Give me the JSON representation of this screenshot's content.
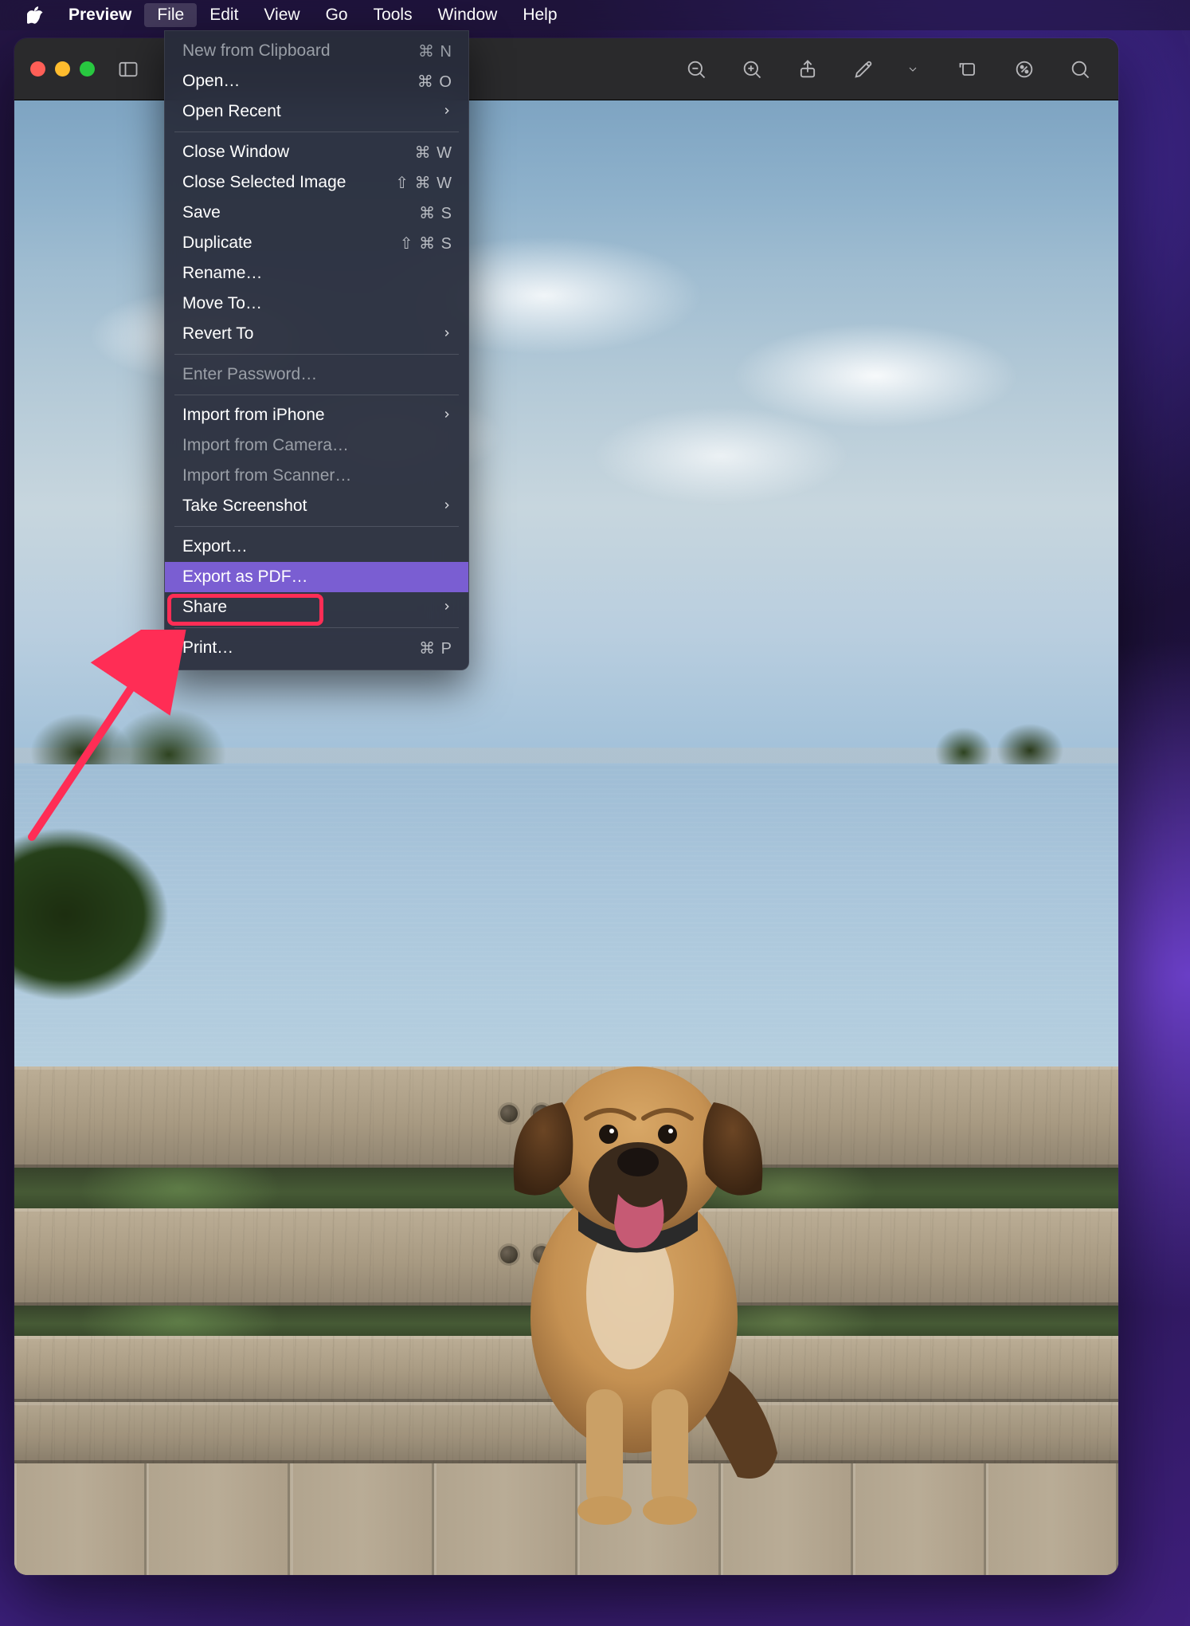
{
  "menubar": {
    "app": "Preview",
    "items": [
      "File",
      "Edit",
      "View",
      "Go",
      "Tools",
      "Window",
      "Help"
    ],
    "active_index": 0
  },
  "file_menu": {
    "groups": [
      [
        {
          "label": "New from Clipboard",
          "shortcut": "⌘ N",
          "dim": true
        },
        {
          "label": "Open…",
          "shortcut": "⌘ O"
        },
        {
          "label": "Open Recent",
          "submenu": true
        }
      ],
      [
        {
          "label": "Close Window",
          "shortcut": "⌘ W"
        },
        {
          "label": "Close Selected Image",
          "shortcut": "⇧ ⌘ W"
        },
        {
          "label": "Save",
          "shortcut": "⌘ S"
        },
        {
          "label": "Duplicate",
          "shortcut": "⇧ ⌘ S"
        },
        {
          "label": "Rename…"
        },
        {
          "label": "Move To…"
        },
        {
          "label": "Revert To",
          "submenu": true
        }
      ],
      [
        {
          "label": "Enter Password…",
          "dim": true
        }
      ],
      [
        {
          "label": "Import from iPhone",
          "submenu": true
        },
        {
          "label": "Import from Camera…",
          "dim": true
        },
        {
          "label": "Import from Scanner…",
          "dim": true
        },
        {
          "label": "Take Screenshot",
          "submenu": true
        }
      ],
      [
        {
          "label": "Export…"
        },
        {
          "label": "Export as PDF…",
          "highlight": true
        },
        {
          "label": "Share",
          "submenu": true
        }
      ],
      [
        {
          "label": "Print…",
          "shortcut": "⌘ P"
        }
      ]
    ]
  },
  "toolbar": {
    "buttons": [
      "sidebar",
      "zoom-out",
      "zoom-in",
      "share",
      "markup",
      "markup-more",
      "rotate",
      "info",
      "search"
    ]
  },
  "annotation": {
    "target": "Export as PDF…"
  }
}
